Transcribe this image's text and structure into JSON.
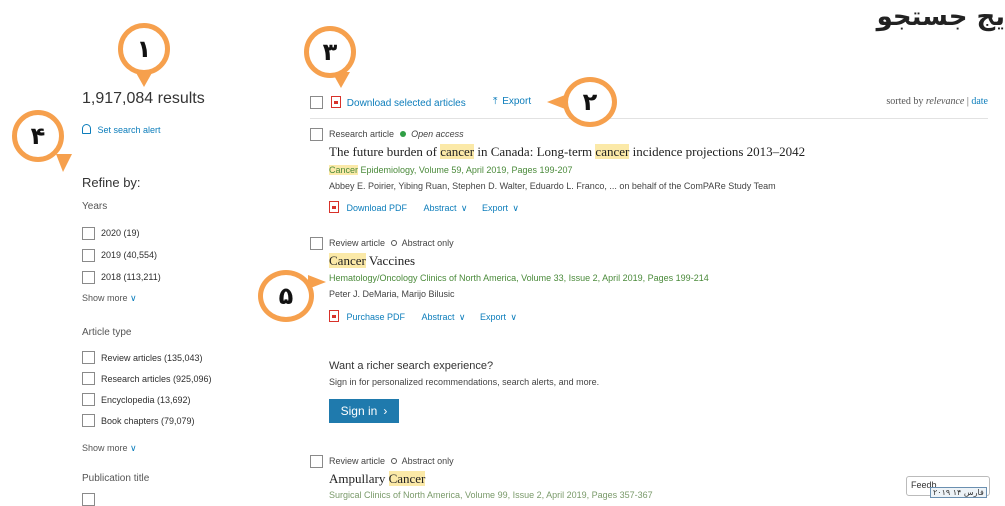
{
  "header": {
    "title": "یج جستجو"
  },
  "results": {
    "count_text": "1,917,084 results",
    "alert_label": "Set search alert"
  },
  "refine": {
    "title": "Refine by:",
    "years": {
      "label": "Years",
      "items": [
        "2020 (19)",
        "2019 (40,554)",
        "2018 (113,211)"
      ],
      "show_more": "Show more"
    },
    "article_type": {
      "label": "Article type",
      "items": [
        "Review articles (135,043)",
        "Research articles (925,096)",
        "Encyclopedia (13,692)",
        "Book chapters (79,079)"
      ],
      "show_more": "Show more"
    },
    "publication": {
      "label": "Publication title"
    }
  },
  "toolbar": {
    "download_label": "Download selected articles",
    "export_label": "Export",
    "sorted_by": "sorted by",
    "relevance": "relevance",
    "separator": "|",
    "date": "date"
  },
  "articles": [
    {
      "type": "Research article",
      "access": "Open access",
      "title_parts": [
        "The future burden of ",
        "cancer",
        " in Canada: Long-term ",
        "cancer",
        " incidence projections 2013–2042"
      ],
      "source_hl": "Cancer",
      "source_rest": " Epidemiology, Volume 59, April 2019, Pages 199-207",
      "authors": "Abbey E. Poirier, Yibing Ruan, Stephen D. Walter, Eduardo L. Franco, ... on behalf of the ComPARe Study Team",
      "pdf_label": "Download PDF",
      "abstract": "Abstract",
      "export": "Export"
    },
    {
      "type": "Review article",
      "access": "Abstract only",
      "title_hl": "Cancer",
      "title_rest": " Vaccines",
      "source": "Hematology/Oncology Clinics of North America, Volume 33, Issue 2, April 2019, Pages 199-214",
      "authors": "Peter J. DeMaria, Marijo Bilusic",
      "pdf_label": "Purchase PDF",
      "abstract": "Abstract",
      "export": "Export"
    },
    {
      "type": "Review article",
      "access": "Abstract only",
      "title_pre": "Ampullary ",
      "title_hl": "Cancer",
      "source": "Surgical Clinics of North America, Volume 99, Issue 2, April 2019, Pages 357-367"
    }
  ],
  "promo": {
    "heading": "Want a richer search experience?",
    "text": "Sign in for personalized recommendations, search alerts, and more.",
    "button": "Sign in"
  },
  "feedback": {
    "label": "Feedb",
    "date_overlay": "فارس ۱۴ ۲۰۱۹"
  },
  "annotations": [
    "۱",
    "۲",
    "۳",
    "۴",
    "۵"
  ],
  "colors": {
    "accent": "#0c7dbb",
    "highlight": "#fbe9a8",
    "annotation": "#f6a04d",
    "signin": "#1f7aad"
  }
}
